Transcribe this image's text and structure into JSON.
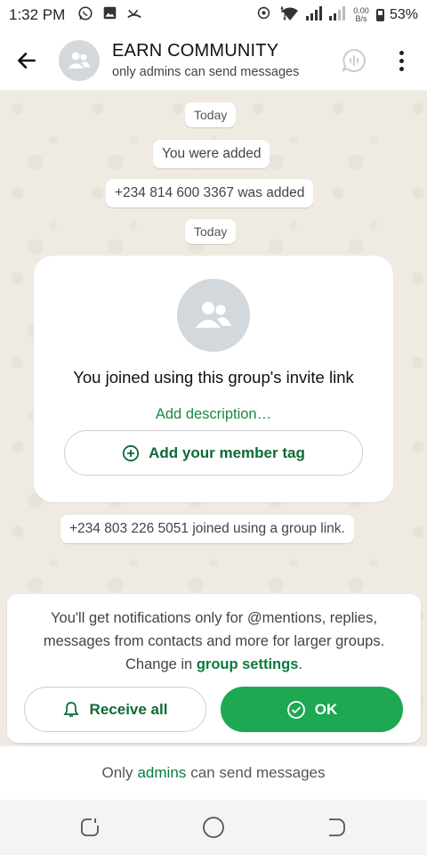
{
  "status_bar": {
    "time": "1:32 PM",
    "net_speed_value": "0.00",
    "net_speed_unit": "B/s",
    "battery": "53%"
  },
  "header": {
    "title": "EARN COMMUNITY",
    "subtitle": "only admins can send messages"
  },
  "chat": {
    "date_1": "Today",
    "msg_added_you": "You were added",
    "msg_added_number": "+234 814 600 3367 was added",
    "date_2": "Today",
    "invite_card": {
      "title": "You joined using this group's invite link",
      "add_description": "Add description…",
      "member_tag_label": "Add your member tag"
    },
    "msg_joined": "+234 803 226 5051 joined using a group link."
  },
  "notification": {
    "text_before": "You'll get notifications only for @mentions, replies, messages from contacts and more for larger groups. Change in ",
    "link": "group settings",
    "text_after": ".",
    "receive_all_label": "Receive all",
    "ok_label": "OK"
  },
  "footer": {
    "prefix": "Only",
    "link": "admins",
    "suffix": "can send messages"
  },
  "colors": {
    "accent_green": "#1da851",
    "link_green": "#0b7a3b",
    "chat_bg": "#efeae2"
  }
}
